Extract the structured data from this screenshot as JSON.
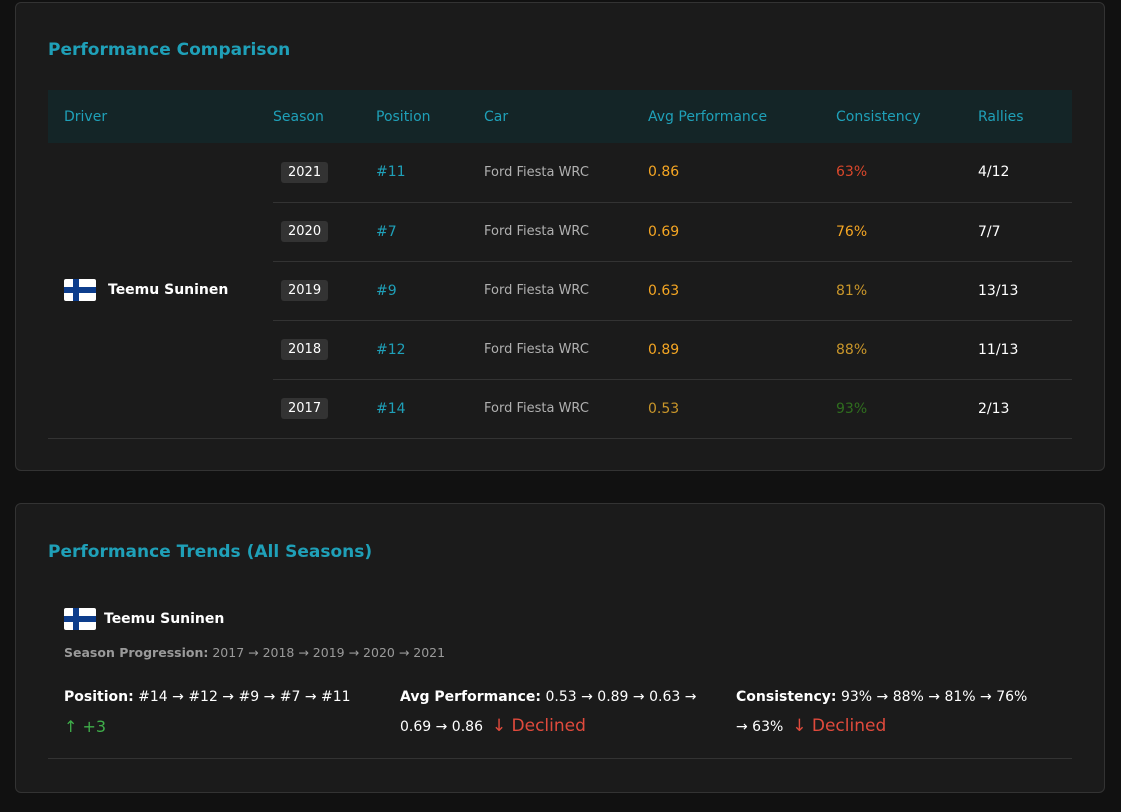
{
  "comparison": {
    "title": "Performance Comparison",
    "columns": [
      "Driver",
      "Season",
      "Position",
      "Car",
      "Avg Performance",
      "Consistency",
      "Rallies"
    ],
    "driver": {
      "name": "Teemu Suninen",
      "flag_icon": "finland-flag-icon"
    },
    "rows": [
      {
        "season": "2021",
        "position": "#11",
        "car": "Ford Fiesta WRC",
        "avg": "0.86",
        "avg_color": "#f5a623",
        "consistency": "63%",
        "consistency_color": "#d9472b",
        "rallies": "4/12"
      },
      {
        "season": "2020",
        "position": "#7",
        "car": "Ford Fiesta WRC",
        "avg": "0.69",
        "avg_color": "#f5a623",
        "consistency": "76%",
        "consistency_color": "#f5a623",
        "rallies": "7/7"
      },
      {
        "season": "2019",
        "position": "#9",
        "car": "Ford Fiesta WRC",
        "avg": "0.63",
        "avg_color": "#f5a623",
        "consistency": "81%",
        "consistency_color": "#c9962a",
        "rallies": "13/13"
      },
      {
        "season": "2018",
        "position": "#12",
        "car": "Ford Fiesta WRC",
        "avg": "0.89",
        "avg_color": "#f5a623",
        "consistency": "88%",
        "consistency_color": "#c9962a",
        "rallies": "11/13"
      },
      {
        "season": "2017",
        "position": "#14",
        "car": "Ford Fiesta WRC",
        "avg": "0.53",
        "avg_color": "#c9962a",
        "consistency": "93%",
        "consistency_color": "#2f6e1e",
        "rallies": "2/13"
      }
    ]
  },
  "trends": {
    "title": "Performance Trends (All Seasons)",
    "driver": {
      "name": "Teemu Suninen",
      "flag_icon": "finland-flag-icon"
    },
    "season_progression_label": "Season Progression:",
    "season_progression": "2017 → 2018 → 2019 → 2020 → 2021",
    "position": {
      "label": "Position:",
      "values": "#14 → #12 → #9 → #7 → #11",
      "trend": "↑ +3",
      "trend_color": "#3fae4a"
    },
    "avg_performance": {
      "label": "Avg Performance:",
      "values": "0.53 → 0.89 → 0.63 → 0.69 → 0.86",
      "trend": "↓ Declined",
      "trend_color": "#e04a3c"
    },
    "consistency": {
      "label": "Consistency:",
      "values": "93% → 88% → 81% → 76% → 63%",
      "trend": "↓ Declined",
      "trend_color": "#e04a3c"
    }
  },
  "colors": {
    "accent": "#1fa0b8",
    "background": "#111111",
    "card": "#1b1b1b",
    "header_row": "#142527"
  }
}
